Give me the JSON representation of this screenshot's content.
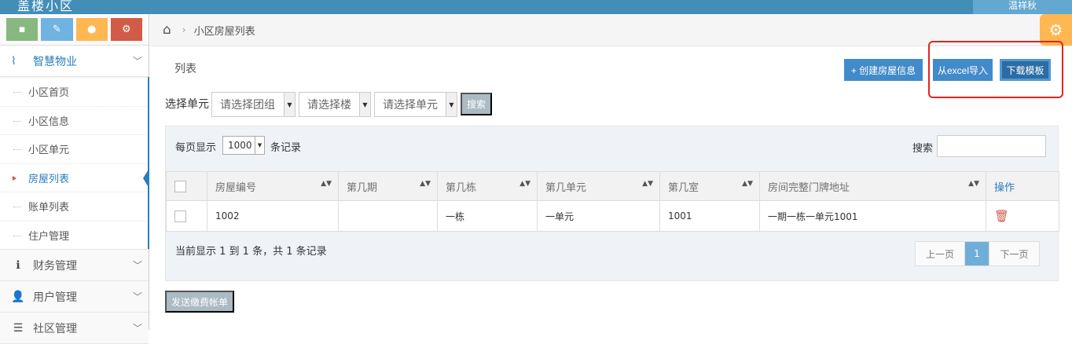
{
  "topbar": {
    "brand": "盖楼小区",
    "user": "温祥秋"
  },
  "shortcuts": [
    {
      "icon": "signal-icon",
      "glyph": "▪",
      "color": "#87b87f"
    },
    {
      "icon": "pencil-icon",
      "glyph": "✎",
      "color": "#6fb3e0"
    },
    {
      "icon": "users-icon",
      "glyph": "●",
      "color": "#ffb752"
    },
    {
      "icon": "cogs-icon",
      "glyph": "⚙",
      "color": "#d15b47"
    }
  ],
  "sidebar": {
    "top": {
      "label": "智慧物业",
      "icon_glyph": "⌇"
    },
    "items": [
      {
        "label": "小区首页"
      },
      {
        "label": "小区信息"
      },
      {
        "label": "小区单元"
      },
      {
        "label": "房屋列表"
      },
      {
        "label": "账单列表"
      },
      {
        "label": "住户管理"
      }
    ],
    "groups": [
      {
        "label": "财务管理",
        "icon_glyph": "ℹ"
      },
      {
        "label": "用户管理",
        "icon_glyph": "👤"
      },
      {
        "label": "社区管理",
        "icon_glyph": "☰"
      }
    ],
    "chevron": "﹀"
  },
  "breadcrumb": {
    "home_glyph": "⌂",
    "sep": "›",
    "current": "小区房屋列表"
  },
  "settings_glyph": "⚙",
  "page": {
    "heading": "列表",
    "btn_create": "+ 创建房屋信息",
    "btn_import": "从excel导入",
    "btn_download": "下载模板"
  },
  "filter": {
    "label": "选择单元",
    "group": "请选择团组",
    "building": "请选择楼",
    "unit": "请选择单元",
    "search": "搜索",
    "dd_glyph": "▼"
  },
  "table": {
    "per_page_label": "每页显示",
    "per_page_value": "1000",
    "per_page_suffix": "条记录",
    "search_label": "搜索",
    "sort_glyph": "▲▼",
    "columns": [
      "房屋编号",
      "第几期",
      "第几栋",
      "第几单元",
      "第几室",
      "房间完整门牌地址",
      "操作"
    ],
    "rows": [
      {
        "no": "1002",
        "phase": "",
        "building": "一栋",
        "unit": "一单元",
        "room": "1001",
        "address": "一期一栋一单元1001",
        "op": "🗑"
      }
    ],
    "info": "当前显示 1 到 1 条，共 1 条记录",
    "pager": {
      "prev": "上一页",
      "current": "1",
      "next": "下一页"
    }
  },
  "send_button": "发送缴费帐单"
}
